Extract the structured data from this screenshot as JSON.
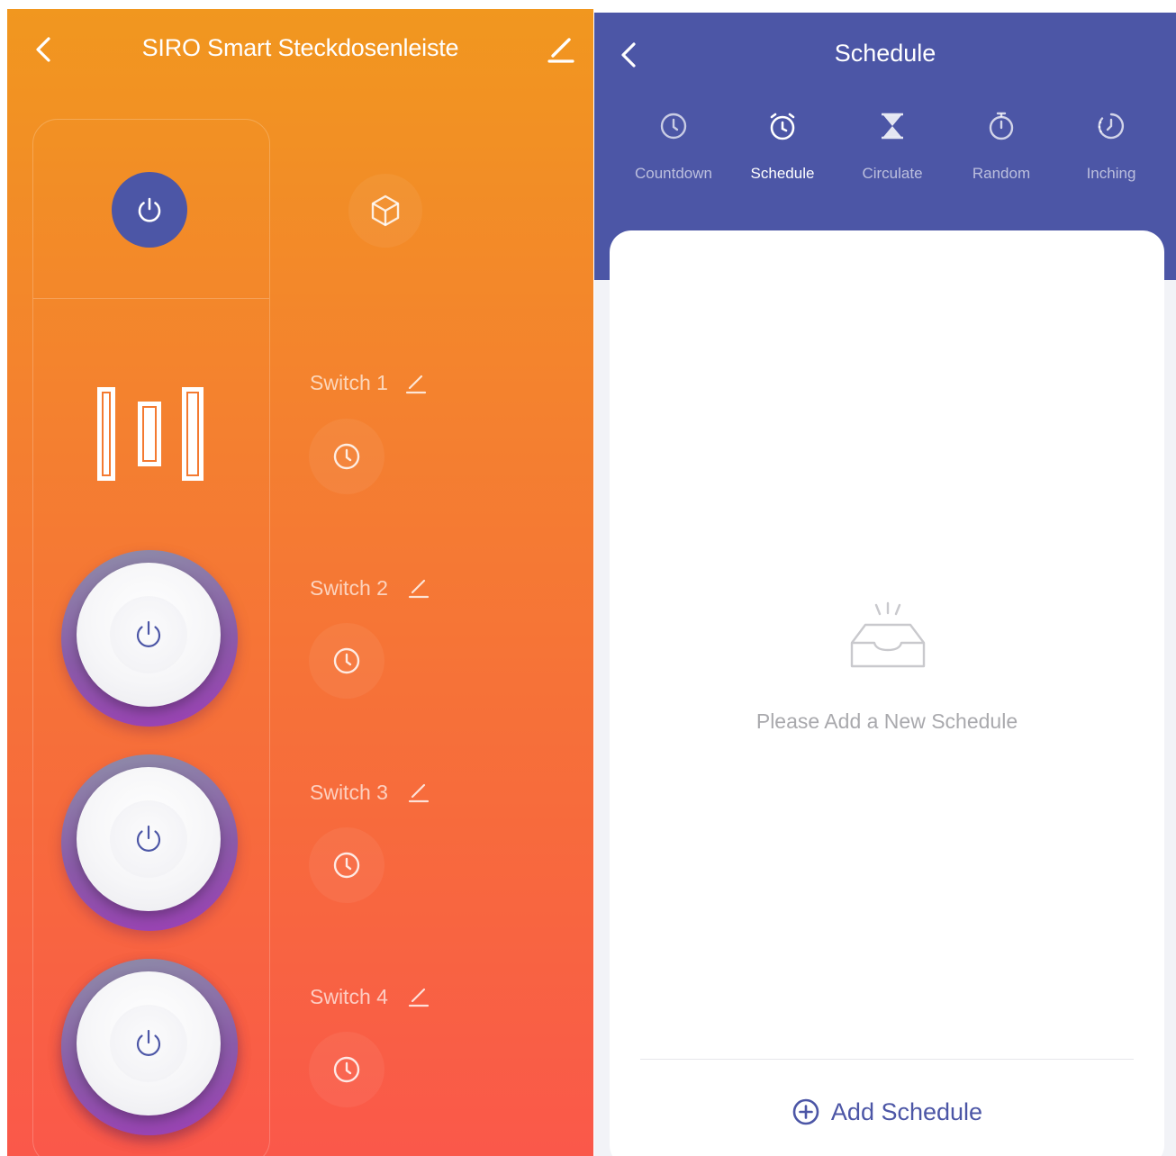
{
  "left_panel": {
    "title": "SIRO Smart Steckdosenleiste",
    "icons": {
      "back": "chevron-left-icon",
      "edit": "pencil-icon",
      "master": "power-icon",
      "scene": "cube-icon"
    },
    "switches": [
      {
        "label": "Switch 1"
      },
      {
        "label": "Switch 2"
      },
      {
        "label": "Switch 3"
      },
      {
        "label": "Switch 4"
      }
    ],
    "colors": {
      "gradient_top": "#f1971f",
      "gradient_bottom": "#fa584a",
      "accent": "#4c56a6"
    }
  },
  "right_panel": {
    "title": "Schedule",
    "tabs": [
      {
        "label": "Countdown",
        "icon": "clock-icon"
      },
      {
        "label": "Schedule",
        "icon": "alarm-clock-icon"
      },
      {
        "label": "Circulate",
        "icon": "hourglass-icon"
      },
      {
        "label": "Random",
        "icon": "stopwatch-icon"
      },
      {
        "label": "Inching",
        "icon": "timer-dotted-icon"
      }
    ],
    "active_tab": "Schedule",
    "empty_message": "Please Add a New Schedule",
    "add_button": "Add Schedule",
    "colors": {
      "header": "#4c56a6",
      "background": "#f2f3f7"
    }
  }
}
